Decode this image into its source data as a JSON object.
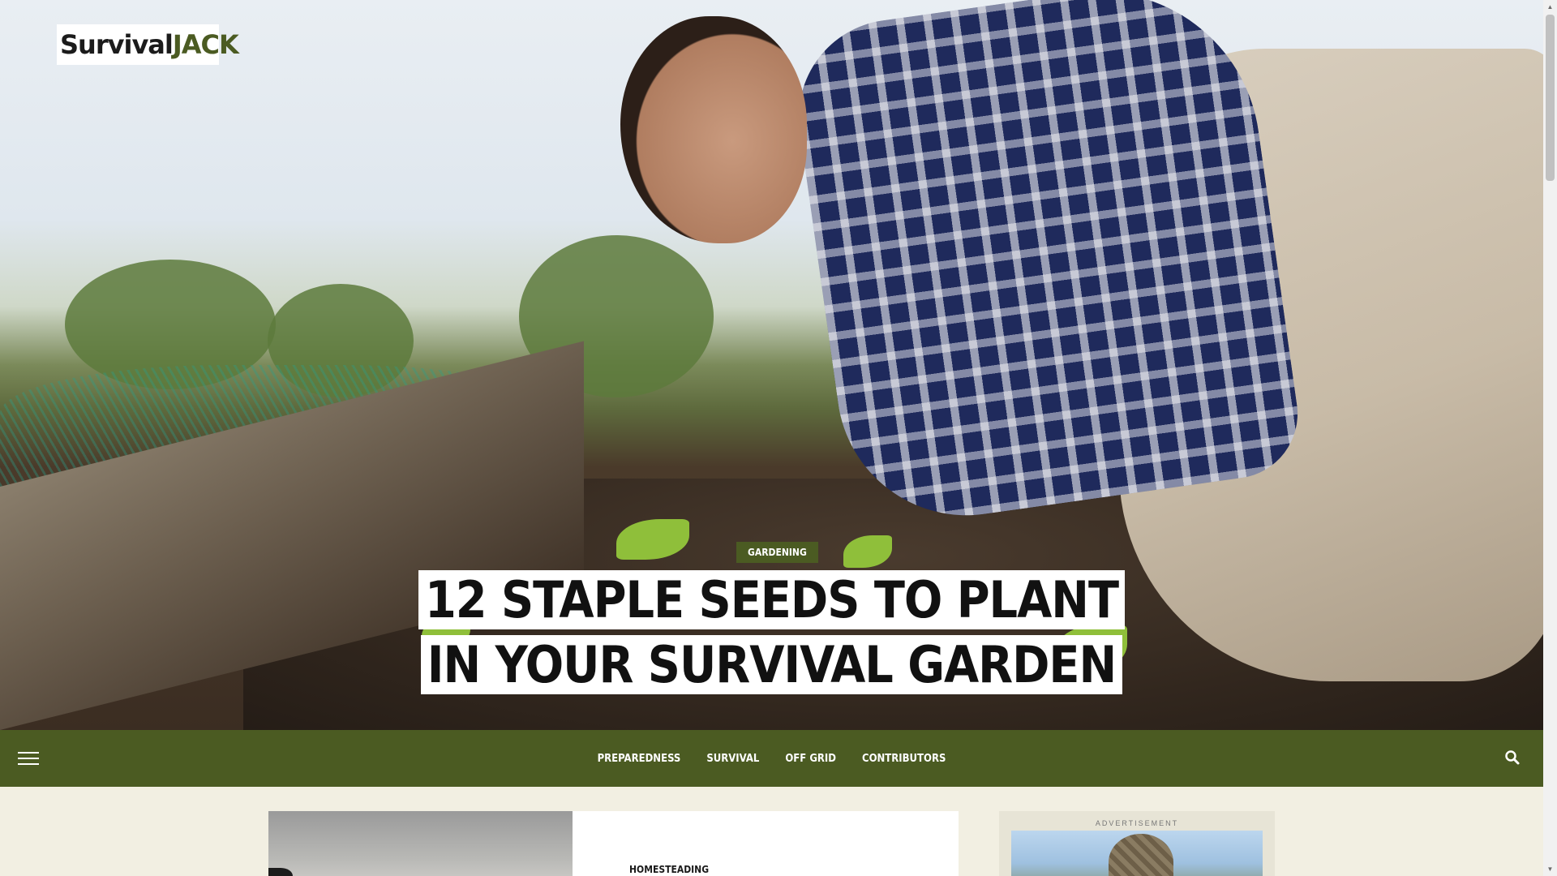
{
  "site": {
    "logo_part1": "Survival",
    "logo_part2": "JACK"
  },
  "hero": {
    "category": "GARDENING",
    "title": "12 STAPLE SEEDS TO PLANT IN YOUR SURVIVAL GARDEN"
  },
  "nav": {
    "items": [
      {
        "label": "PREPAREDNESS"
      },
      {
        "label": "SURVIVAL"
      },
      {
        "label": "OFF GRID"
      },
      {
        "label": "CONTRIBUTORS"
      }
    ],
    "menu_icon": "hamburger-icon",
    "search_icon": "search-icon"
  },
  "feed": {
    "first_card_category": "HOMESTEADING"
  },
  "sidebar": {
    "ad_label": "ADVERTISEMENT"
  },
  "colors": {
    "brand_green": "#4b5b22",
    "page_background": "#f2efe2",
    "white": "#ffffff"
  }
}
